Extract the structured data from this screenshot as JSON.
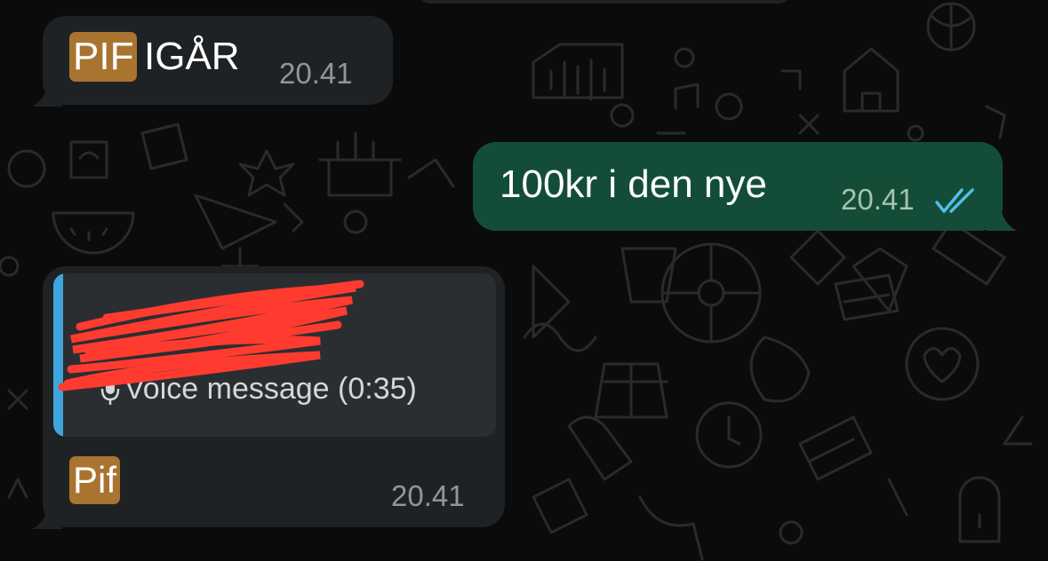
{
  "messages": [
    {
      "tag": "PIF",
      "text": "IGÅR",
      "time": "20.41",
      "direction": "incoming"
    },
    {
      "text": "100kr i den nye",
      "time": "20.41",
      "direction": "outgoing",
      "status": "read",
      "status_icon": "double-check-icon"
    },
    {
      "reply_preview": {
        "icon": "mic-icon",
        "text": "Voice message (0:35)",
        "sender_redacted": true
      },
      "tag": "Pif",
      "time": "20.41",
      "direction": "incoming"
    }
  ],
  "colors": {
    "background": "#0b0b0b",
    "incoming_bubble": "#1f2224",
    "outgoing_bubble": "#134d37",
    "tag_background": "#a8742f",
    "quote_bar": "#3fa6dd",
    "read_ticks": "#53bdeb",
    "redaction": "#ff3b30"
  }
}
